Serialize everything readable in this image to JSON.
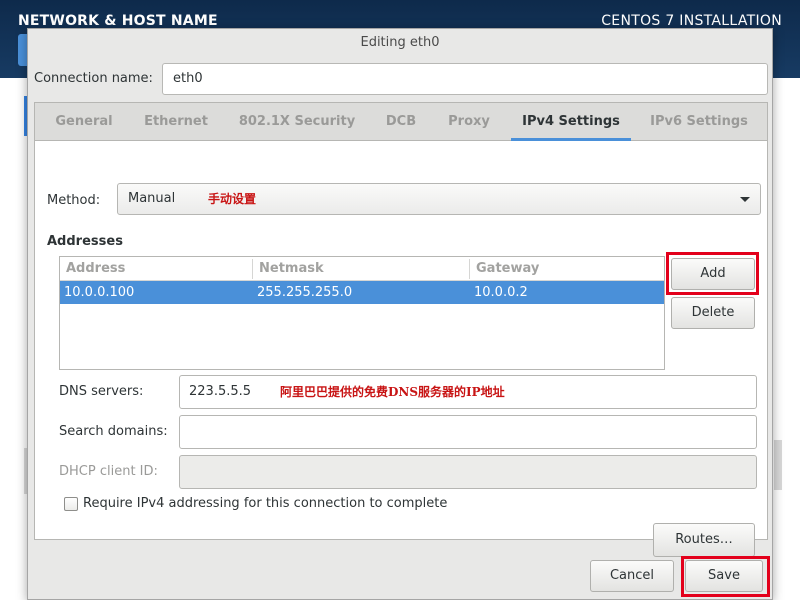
{
  "background": {
    "page_title": "NETWORK & HOST NAME",
    "product": "CENTOS 7 INSTALLATION"
  },
  "dialog": {
    "title": "Editing eth0",
    "connection_name_label": "Connection name:",
    "connection_name": "eth0",
    "tabs": [
      {
        "label": "General",
        "active": false
      },
      {
        "label": "Ethernet",
        "active": false
      },
      {
        "label": "802.1X Security",
        "active": false
      },
      {
        "label": "DCB",
        "active": false
      },
      {
        "label": "Proxy",
        "active": false
      },
      {
        "label": "IPv4 Settings",
        "active": true
      },
      {
        "label": "IPv6 Settings",
        "active": false
      }
    ],
    "method_label": "Method:",
    "method_value": "Manual",
    "method_note": "手动设置",
    "addresses_heading": "Addresses",
    "addresses_columns": [
      "Address",
      "Netmask",
      "Gateway"
    ],
    "addresses_rows": [
      {
        "address": "10.0.0.100",
        "netmask": "255.255.255.0",
        "gateway": "10.0.0.2",
        "selected": true
      }
    ],
    "add_label": "Add",
    "delete_label": "Delete",
    "dns_label": "DNS servers:",
    "dns_value": "223.5.5.5",
    "dns_note": "阿里巴巴提供的免费DNS服务器的IP地址",
    "search_domains_label": "Search domains:",
    "search_domains_value": "",
    "dhcp_client_id_label": "DHCP client ID:",
    "dhcp_client_id_value": "",
    "require_ipv4_label": "Require IPv4 addressing for this connection to complete",
    "require_ipv4_checked": false,
    "routes_label": "Routes…",
    "cancel_label": "Cancel",
    "save_label": "Save"
  },
  "colors": {
    "header_bg": "#173b63",
    "selection": "#4a90d9",
    "annotation_red": "#c81414",
    "highlight_frame": "#e3001b"
  }
}
